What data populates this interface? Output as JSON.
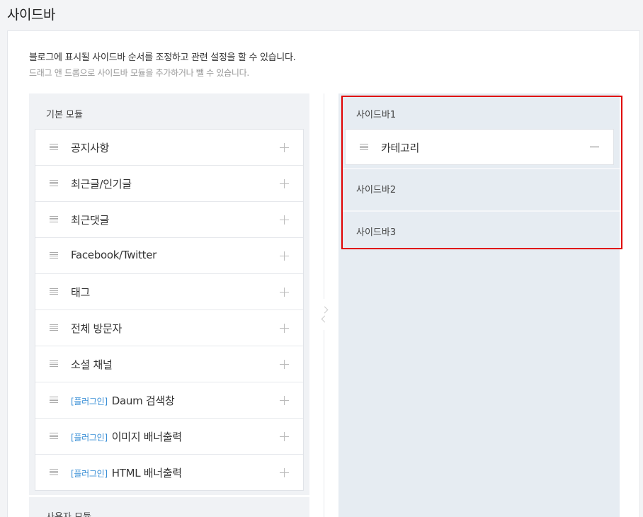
{
  "page": {
    "title": "사이드바"
  },
  "description": {
    "line1": "블로그에 표시될 사이드바 순서를 조정하고 관련 설정을 할 수 있습니다.",
    "line2": "드래그 앤 드롭으로 사이드바 모듈을 추가하거나 뺄 수 있습니다."
  },
  "basic_modules": {
    "title": "기본 모듈",
    "items": [
      {
        "tag": "",
        "label": "공지사항"
      },
      {
        "tag": "",
        "label": "최근글/인기글"
      },
      {
        "tag": "",
        "label": "최근댓글"
      },
      {
        "tag": "",
        "label": "Facebook/Twitter"
      },
      {
        "tag": "",
        "label": "태그"
      },
      {
        "tag": "",
        "label": "전체 방문자"
      },
      {
        "tag": "",
        "label": "소셜 채널"
      },
      {
        "tag": "[플러그인]",
        "label": "Daum 검색창"
      },
      {
        "tag": "[플러그인]",
        "label": "이미지 배너출력"
      },
      {
        "tag": "[플러그인]",
        "label": "HTML 배너출력"
      }
    ]
  },
  "user_modules": {
    "title": "사용자 모듈"
  },
  "sidebars": [
    {
      "title": "사이드바1",
      "items": [
        {
          "label": "카테고리"
        }
      ]
    },
    {
      "title": "사이드바2",
      "items": []
    },
    {
      "title": "사이드바3",
      "items": []
    }
  ],
  "icons": {
    "drag": "drag-handle-icon",
    "add": "plus-icon",
    "remove": "minus-icon",
    "move_right": "chevron-right-icon",
    "move_left": "chevron-left-icon"
  },
  "colors": {
    "plugin_tag": "#3a8fd6",
    "highlight": "#e00000",
    "sidebar_bg": "#e6ecf2",
    "module_bg": "#f0f2f5"
  }
}
